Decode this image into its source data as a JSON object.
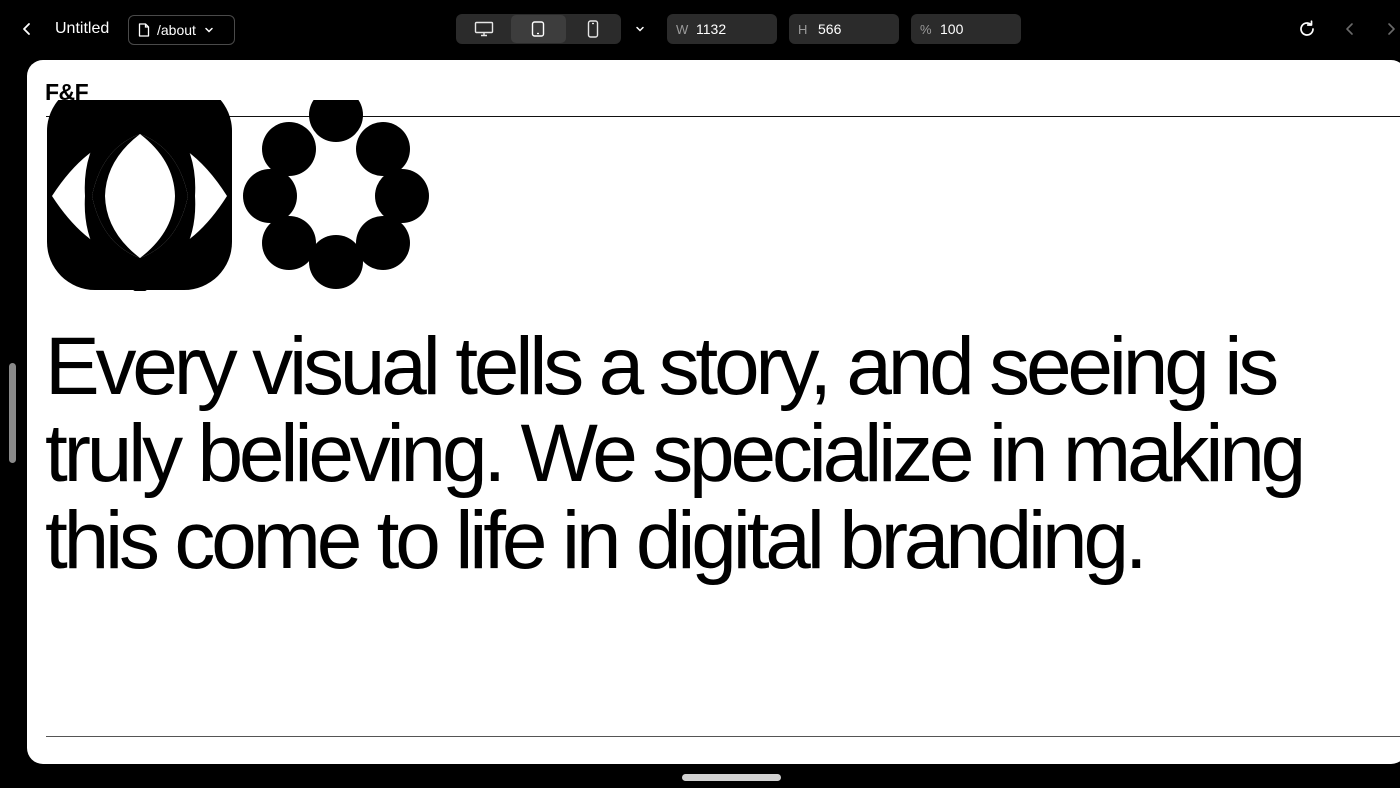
{
  "toolbar": {
    "title": "Untitled",
    "page_path": "/about",
    "width_label": "W",
    "width_value": "1132",
    "height_label": "H",
    "height_value": "566",
    "zoom_label": "%",
    "zoom_value": "100",
    "active_device": "tablet"
  },
  "preview": {
    "logo": "F&F",
    "headline": "Every visual tells a story, and seeing is truly believing. We specialize in making this come to life in digital branding."
  },
  "icons": [
    "back-icon",
    "page-icon",
    "chevron-down-icon",
    "desktop-icon",
    "tablet-icon",
    "phone-icon",
    "reload-icon",
    "arrow-left-icon",
    "arrow-right-icon"
  ],
  "colors": {
    "toolbar_bg": "#000000",
    "field_bg": "#2b2b2b",
    "canvas_bg": "#ffffff",
    "text": "#000000"
  }
}
